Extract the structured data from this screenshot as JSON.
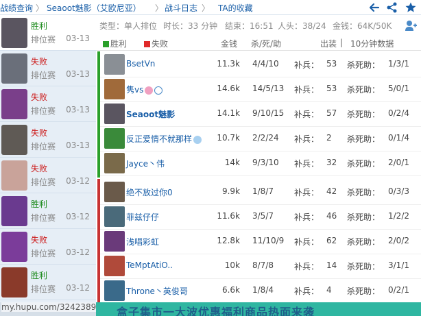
{
  "nav": {
    "items": [
      "战绩查询",
      "Seaoot魅影（艾欧尼亚）",
      "战斗日志",
      "TA的收藏"
    ],
    "separator": "〉"
  },
  "sidebar": {
    "matches": [
      {
        "result": "胜利",
        "outcome": "win",
        "mode": "排位赛",
        "date": "03-13",
        "avatar_color": "#5a5560"
      },
      {
        "result": "失败",
        "outcome": "lose",
        "mode": "排位赛",
        "date": "03-13",
        "avatar_color": "#6a6f7a"
      },
      {
        "result": "失败",
        "outcome": "lose",
        "mode": "排位赛",
        "date": "03-13",
        "avatar_color": "#7a3f8a"
      },
      {
        "result": "失败",
        "outcome": "lose",
        "mode": "排位赛",
        "date": "03-13",
        "avatar_color": "#5f5a55"
      },
      {
        "result": "失败",
        "outcome": "lose",
        "mode": "排位赛",
        "date": "03-12",
        "avatar_color": "#c9a39a"
      },
      {
        "result": "胜利",
        "outcome": "win",
        "mode": "排位赛",
        "date": "03-12",
        "avatar_color": "#6a3a8f"
      },
      {
        "result": "失败",
        "outcome": "lose",
        "mode": "排位赛",
        "date": "03-12",
        "avatar_color": "#7b3c9a"
      },
      {
        "result": "胜利",
        "outcome": "win",
        "mode": "排位赛",
        "date": "03-12",
        "avatar_color": "#8a3a2a"
      }
    ]
  },
  "info": {
    "type": "类型：单人排位",
    "duration": "时长：33 分钟",
    "end": "结束：16:51",
    "kills": "人头：38/24",
    "gold": "金钱：64K/50K"
  },
  "table_header": {
    "win": "胜利",
    "lose": "失败",
    "gold": "金钱",
    "kda": "杀/死/助",
    "items": "出装",
    "sep": "|",
    "ten_min": "10分钟数据",
    "win_color": "#2aa02a",
    "lose_color": "#e02a2a"
  },
  "players": [
    {
      "name": "BsetVn",
      "gold": "11.3k",
      "kda": "4/4/10",
      "cs_label": "补兵：",
      "cs": "53",
      "kp_label": "杀死助：",
      "kp": "1/3/1",
      "avatar_color": "#8a8f95"
    },
    {
      "name": "隽vs",
      "gold": "14.6k",
      "kda": "14/5/13",
      "cs_label": "补兵：",
      "cs": "53",
      "kp_label": "杀死助：",
      "kp": "5/0/1",
      "avatar_color": "#a06a3a"
    },
    {
      "name": "Seaoot魅影",
      "gold": "14.1k",
      "kda": "9/10/15",
      "cs_label": "补兵：",
      "cs": "57",
      "kp_label": "杀死助：",
      "kp": "0/2/4",
      "avatar_color": "#5a5560"
    },
    {
      "name": "反正爱情不就那样",
      "gold": "10.7k",
      "kda": "2/2/24",
      "cs_label": "补兵：",
      "cs": "2",
      "kp_label": "杀死助：",
      "kp": "0/1/4",
      "avatar_color": "#3a8a3a"
    },
    {
      "name": "Jayce丶伟",
      "gold": "14k",
      "kda": "9/3/10",
      "cs_label": "补兵：",
      "cs": "32",
      "kp_label": "杀死助：",
      "kp": "2/0/1",
      "avatar_color": "#7a6a4a"
    },
    {
      "name": "绝不放过你0",
      "gold": "9.9k",
      "kda": "1/8/7",
      "cs_label": "补兵：",
      "cs": "42",
      "kp_label": "杀死助：",
      "kp": "0/3/3",
      "avatar_color": "#6a5a4a"
    },
    {
      "name": "菲兹仔仔",
      "gold": "11.6k",
      "kda": "3/5/7",
      "cs_label": "补兵：",
      "cs": "46",
      "kp_label": "杀死助：",
      "kp": "1/2/2",
      "avatar_color": "#4a6a7a"
    },
    {
      "name": "浅唱彩虹",
      "gold": "12.8k",
      "kda": "11/10/9",
      "cs_label": "补兵：",
      "cs": "62",
      "kp_label": "杀死助：",
      "kp": "2/0/2",
      "avatar_color": "#6a3a7a"
    },
    {
      "name": "TeMptAtiO..",
      "gold": "10k",
      "kda": "8/7/8",
      "cs_label": "补兵：",
      "cs": "14",
      "kp_label": "杀死助：",
      "kp": "3/1/1",
      "avatar_color": "#b04a3a"
    },
    {
      "name": "Throne丶英俊哥",
      "gold": "6.6k",
      "kda": "1/8/4",
      "cs_label": "补兵：",
      "cs": "4",
      "kp_label": "杀死助：",
      "kp": "0/2/1",
      "avatar_color": "#3a6a8a"
    }
  ],
  "watermark": "my.hupu.com/3242389",
  "banner": "盒子集市一大波优惠福利商品热面来袭",
  "colors": {
    "link": "#1a5fa8",
    "win_bar": "#2aa02a",
    "lose_bar": "#c83232",
    "sidebar_bg": "#e6eef6",
    "banner_bg": "#2fb6a1"
  },
  "icons": [
    "back-arrow-icon",
    "share-icon",
    "star-icon",
    "refresh-icon"
  ]
}
